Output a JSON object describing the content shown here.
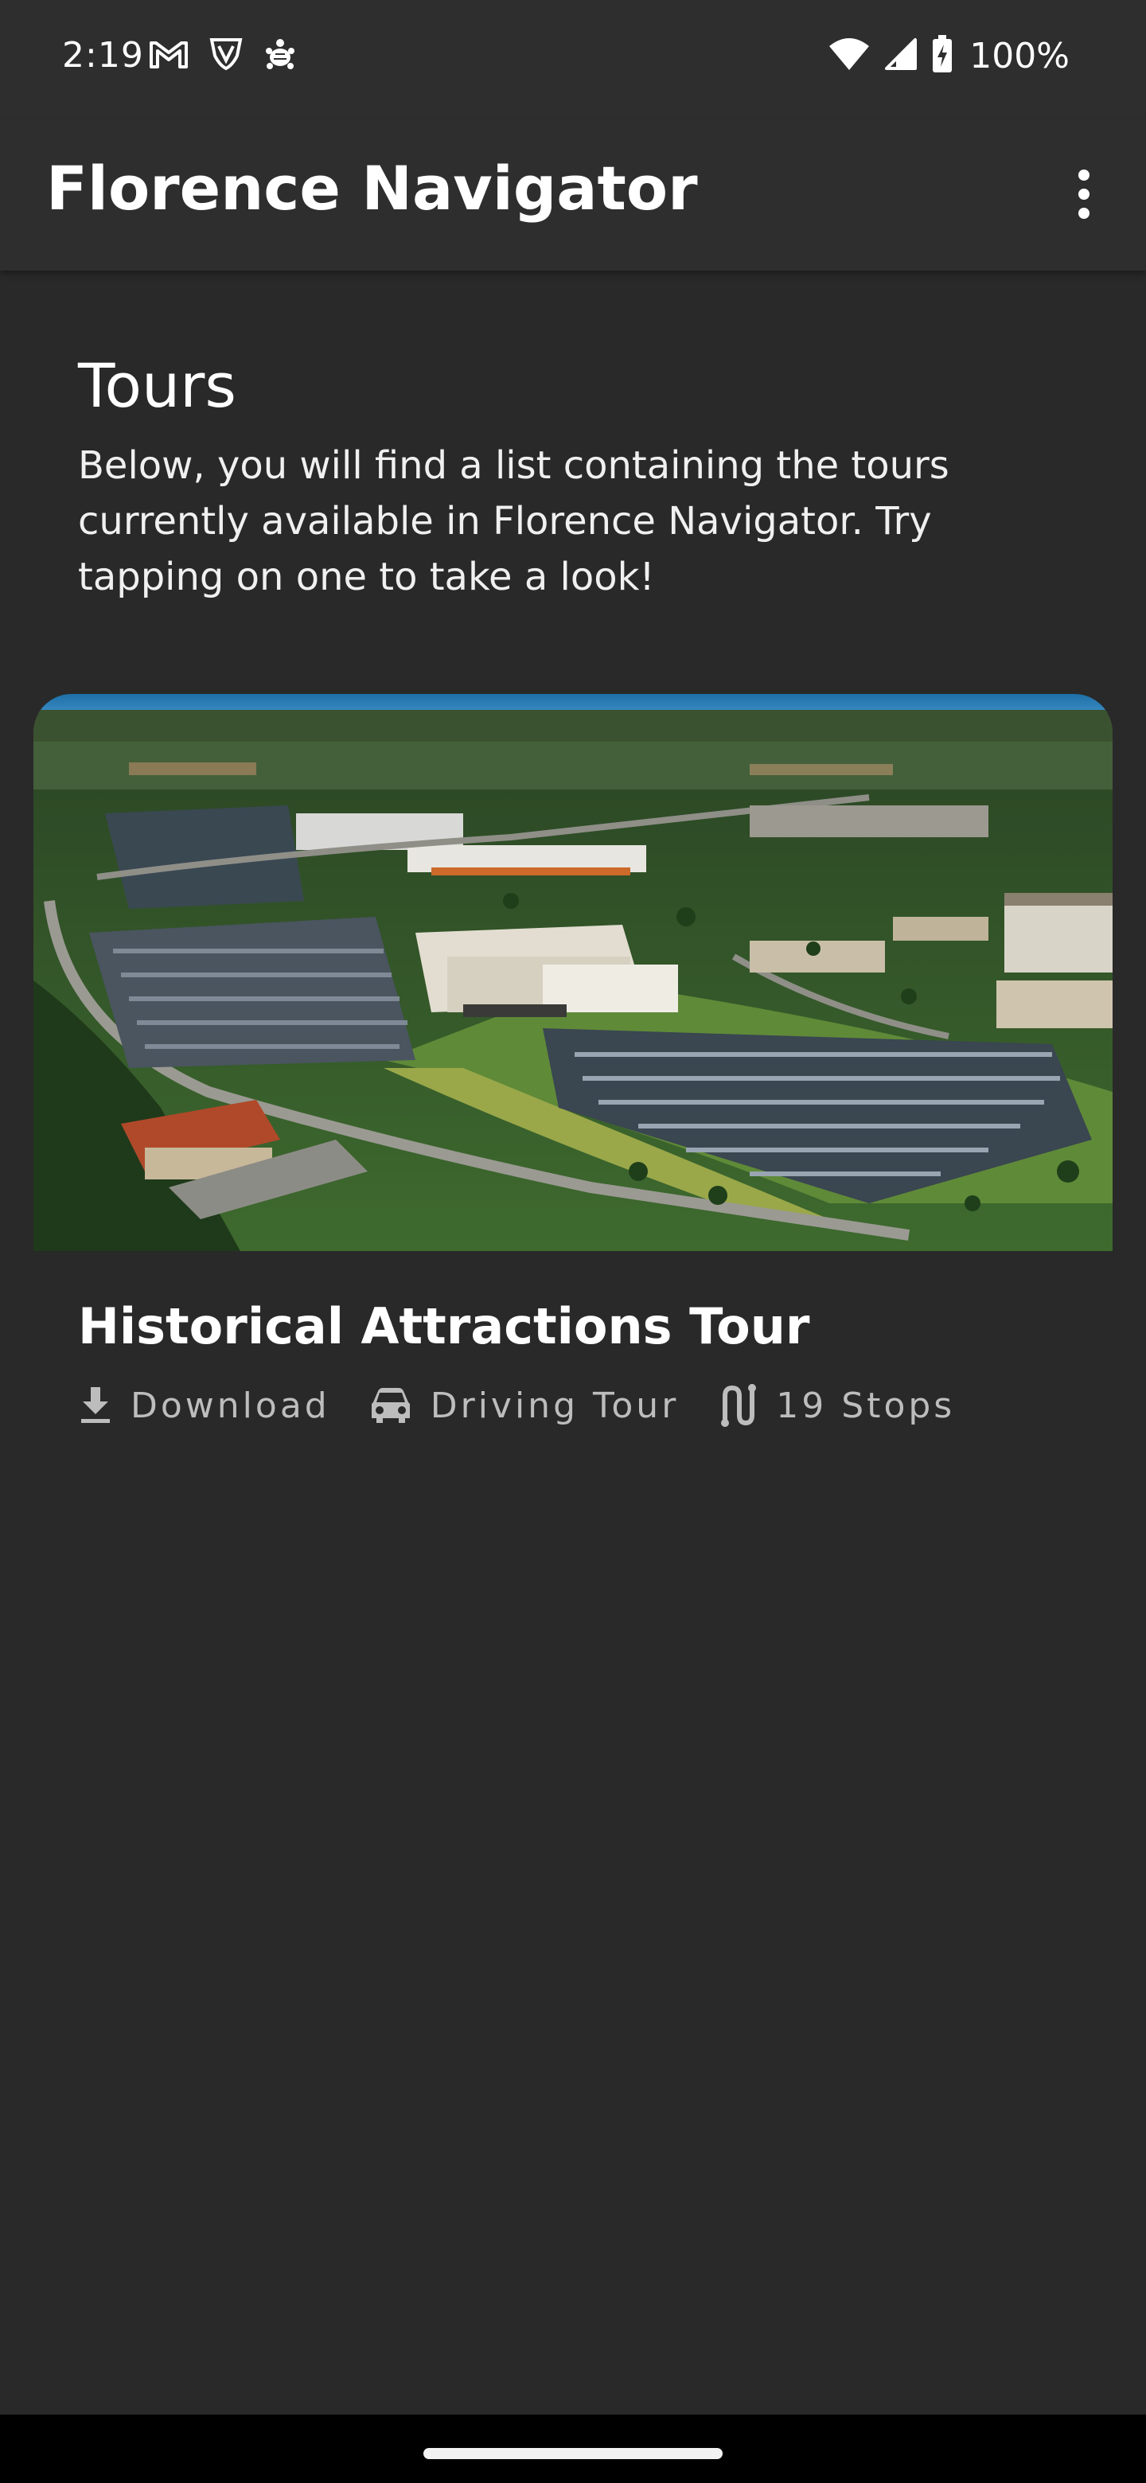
{
  "status_bar": {
    "time": "2:19",
    "left_icons": [
      "gmail-icon",
      "vpn-shield-icon",
      "turtle-icon"
    ],
    "right_icons": [
      "wifi-icon",
      "cell-signal-icon",
      "battery-charging-icon"
    ],
    "battery_percent": "100%"
  },
  "app_bar": {
    "title": "Florence Navigator",
    "menu_icon": "more-vert-icon"
  },
  "content": {
    "heading": "Tours",
    "description": "Below, you will find a list containing the tours currently available in Florence Navigator. Try tapping on one to take a look!"
  },
  "tours": [
    {
      "title": "Historical Attractions Tour",
      "image": "aerial-photo-of-convention-center-and-parking-lots",
      "meta": [
        {
          "icon": "download-icon",
          "label": "Download"
        },
        {
          "icon": "car-icon",
          "label": "Driving Tour"
        },
        {
          "icon": "route-icon",
          "label": "19 Stops"
        }
      ]
    }
  ],
  "colors": {
    "background": "#292929",
    "app_bar": "#2e2e2e",
    "meta_text": "#bdbdbd"
  }
}
